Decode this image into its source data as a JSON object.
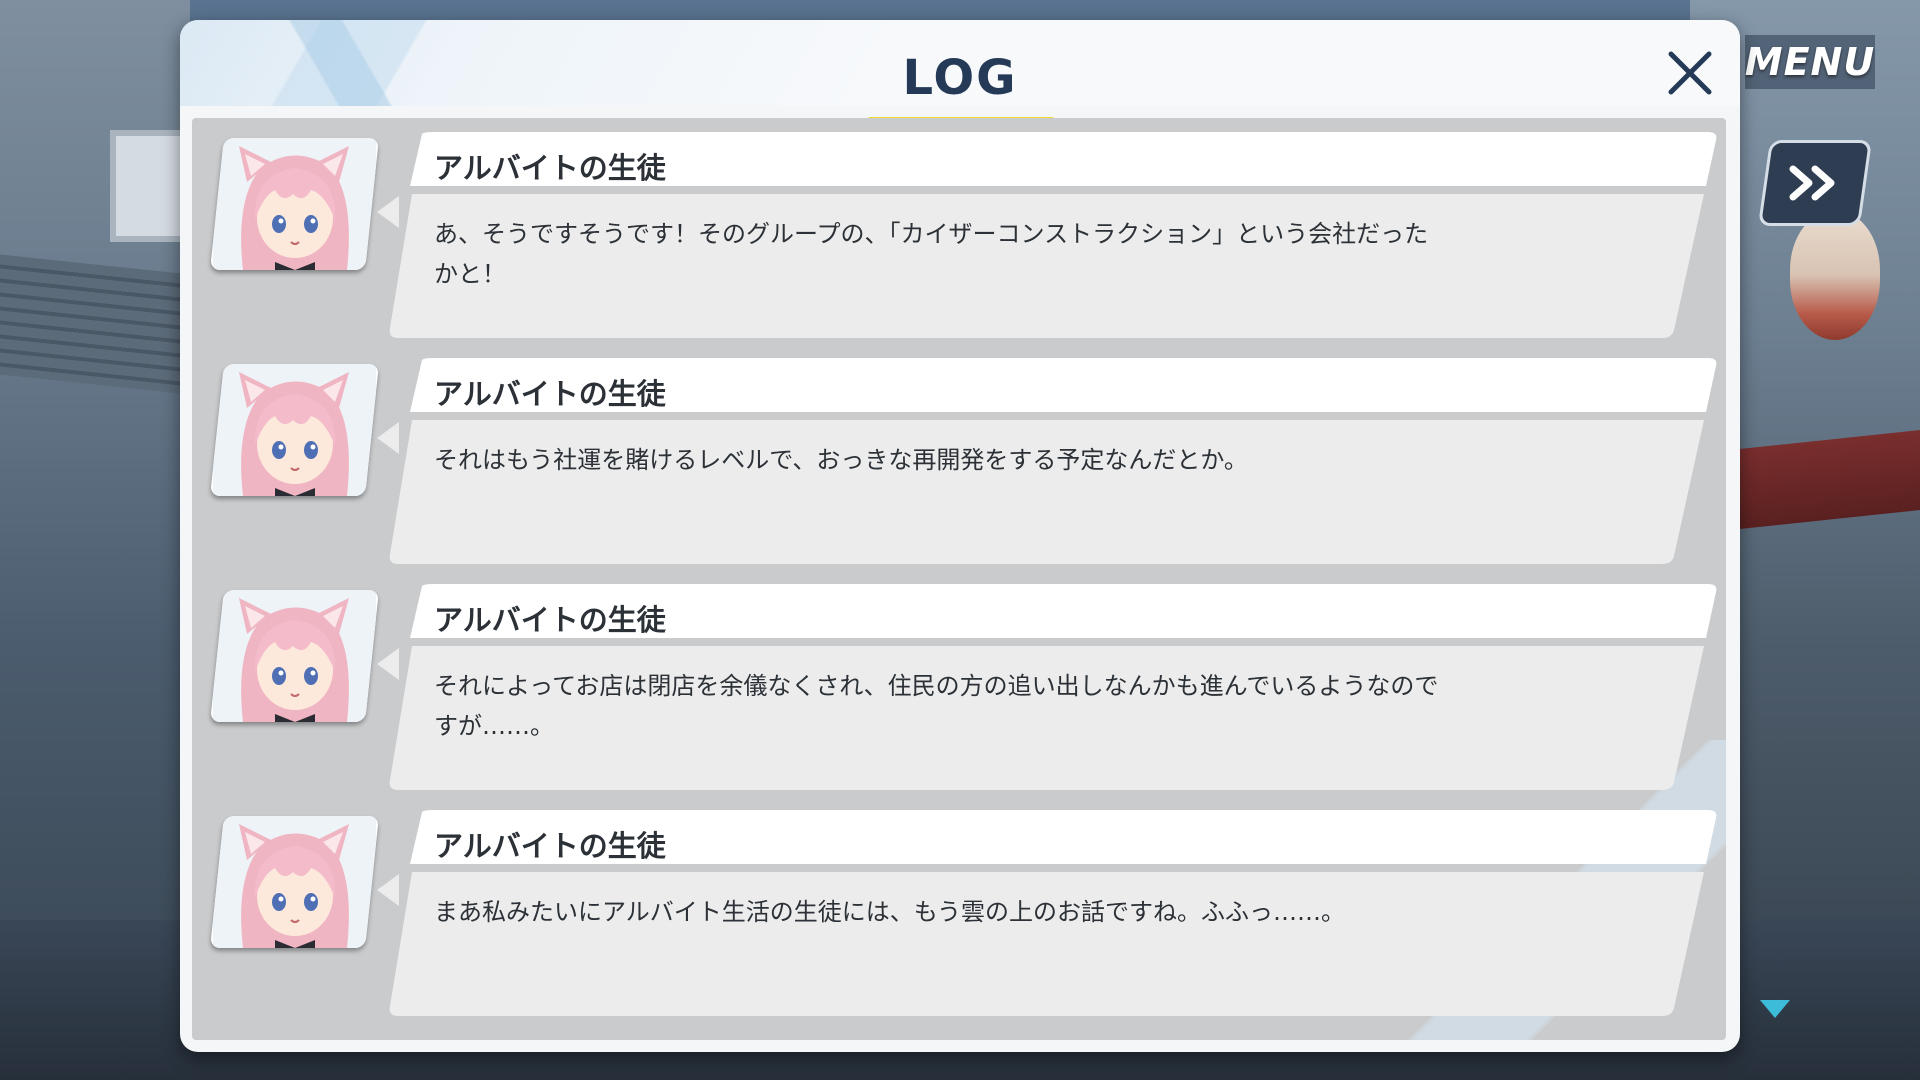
{
  "hud": {
    "menu_label": "MENU",
    "auto_icon": "fast-forward-icon"
  },
  "log": {
    "title": "LOG",
    "close_icon": "close-icon",
    "accent_color": "#f1dc2b",
    "entries": [
      {
        "speaker": "アルバイトの生徒",
        "text": "あ、そうですそうです！そのグループの、「カイザーコンストラクション」という会社だった\nかと！"
      },
      {
        "speaker": "アルバイトの生徒",
        "text": "それはもう社運を賭けるレベルで、おっきな再開発をする予定なんだとか。"
      },
      {
        "speaker": "アルバイトの生徒",
        "text": "それによってお店は閉店を余儀なくされ、住民の方の追い出しなんかも進んでいるようなので\nすが……。"
      },
      {
        "speaker": "アルバイトの生徒",
        "text": "まあ私みたいにアルバイト生活の生徒には、もう雲の上のお話ですね。ふふっ……。"
      }
    ]
  }
}
